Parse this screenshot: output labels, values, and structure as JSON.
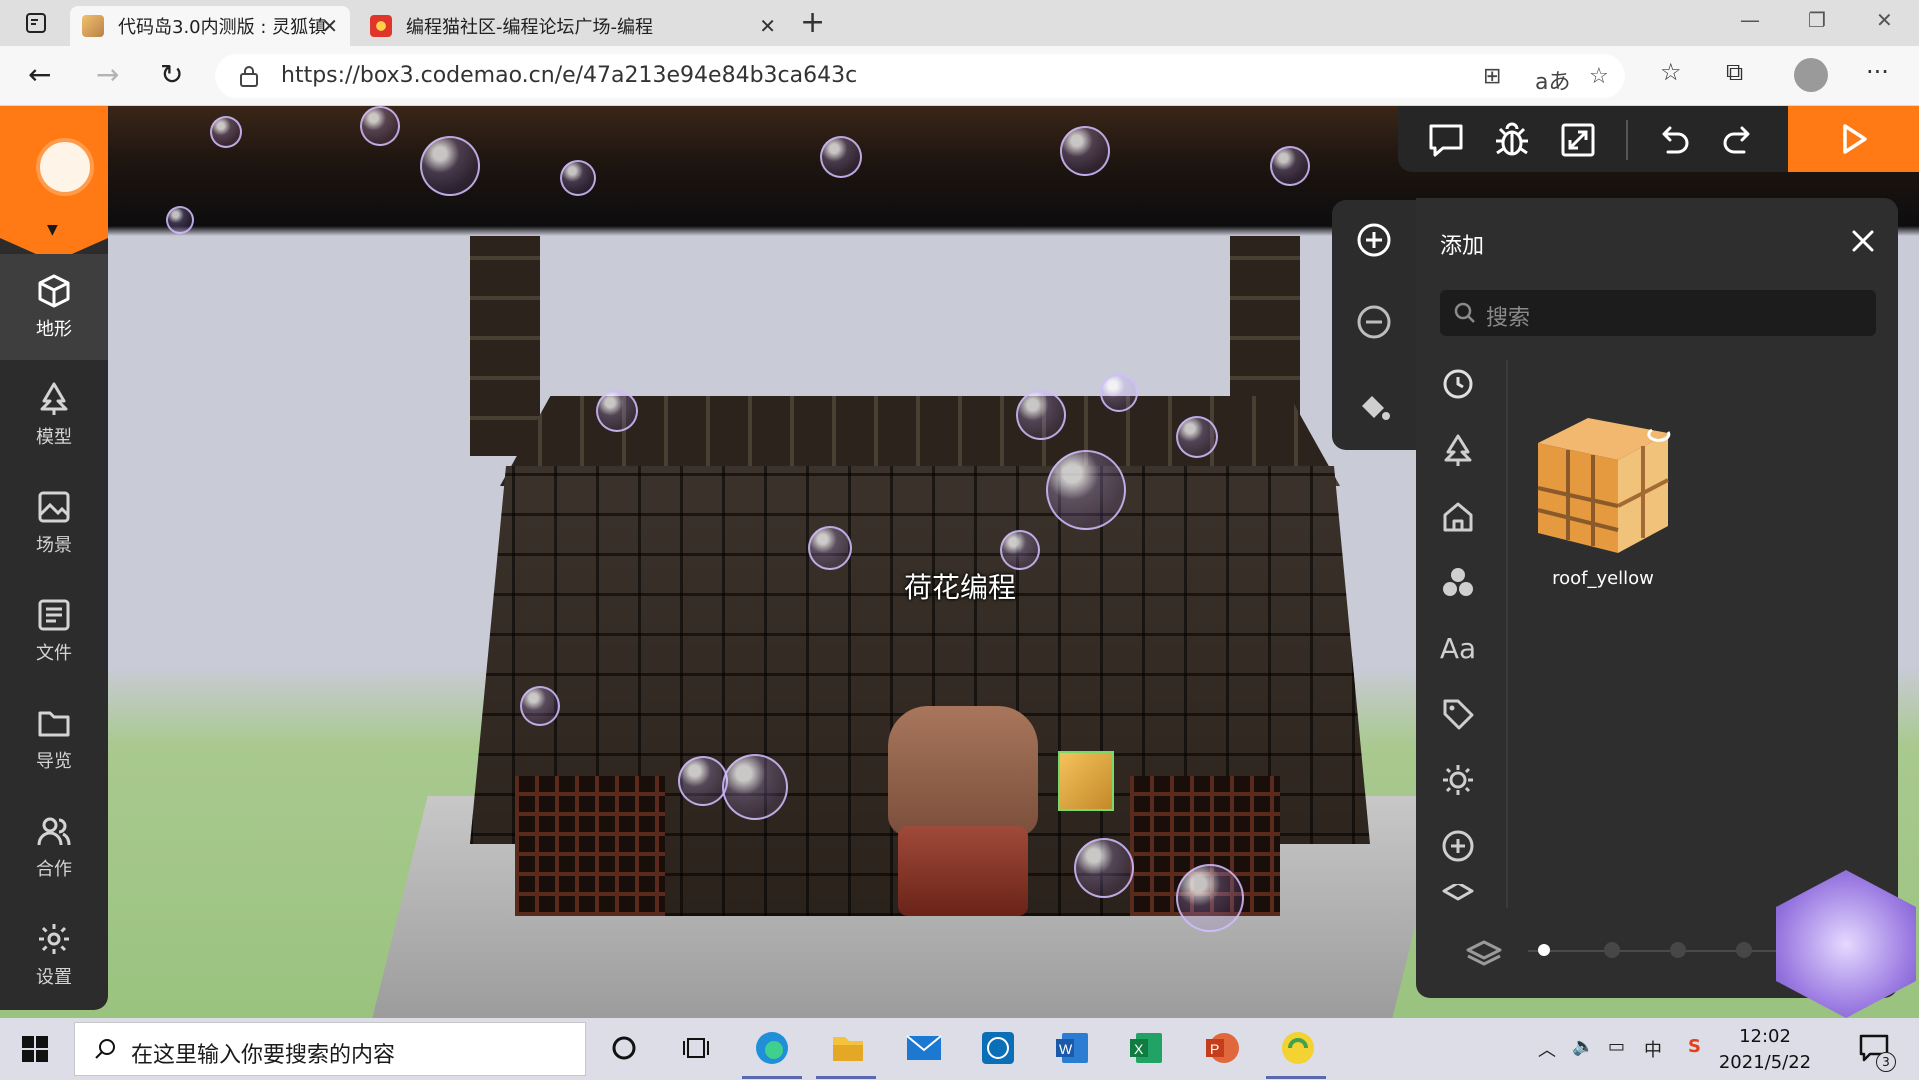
{
  "browser": {
    "tabs": [
      {
        "title": "代码岛3.0内测版 : 灵狐镇",
        "close": "✕"
      },
      {
        "title": "编程猫社区-编程论坛广场-编程",
        "close": "✕"
      }
    ],
    "new_tab": "+",
    "url": "https://box3.codemao.cn/e/47a213e94e84b3ca643c",
    "read_aloud": "aあ"
  },
  "sidebar": {
    "items": [
      {
        "label": "地形",
        "icon": "cube-icon"
      },
      {
        "label": "模型",
        "icon": "tree-icon"
      },
      {
        "label": "场景",
        "icon": "image-icon"
      },
      {
        "label": "文件",
        "icon": "file-list-icon"
      },
      {
        "label": "导览",
        "icon": "folder-icon"
      },
      {
        "label": "合作",
        "icon": "users-icon"
      },
      {
        "label": "设置",
        "icon": "gear-icon"
      }
    ]
  },
  "scene": {
    "npc_name": "荷花编程"
  },
  "add_panel": {
    "title": "添加",
    "search_placeholder": "搜索",
    "categories": [
      "recent-icon",
      "tree-icon",
      "house-icon",
      "shapes-icon",
      "text-icon",
      "tag-icon",
      "light-icon",
      "plus-icon",
      "layer-icon"
    ],
    "category_text": "Aa",
    "asset": {
      "name": "roof_yellow"
    },
    "page_count": 4,
    "current_page": 1
  },
  "taskbar": {
    "search_placeholder": "在这里输入你要搜索的内容",
    "time": "12:02",
    "date": "2021/5/22",
    "notifications": "3"
  },
  "colors": {
    "accent": "#ff7a14",
    "panel": "#2e2e2e",
    "sidebar": "#2c2c2c"
  }
}
